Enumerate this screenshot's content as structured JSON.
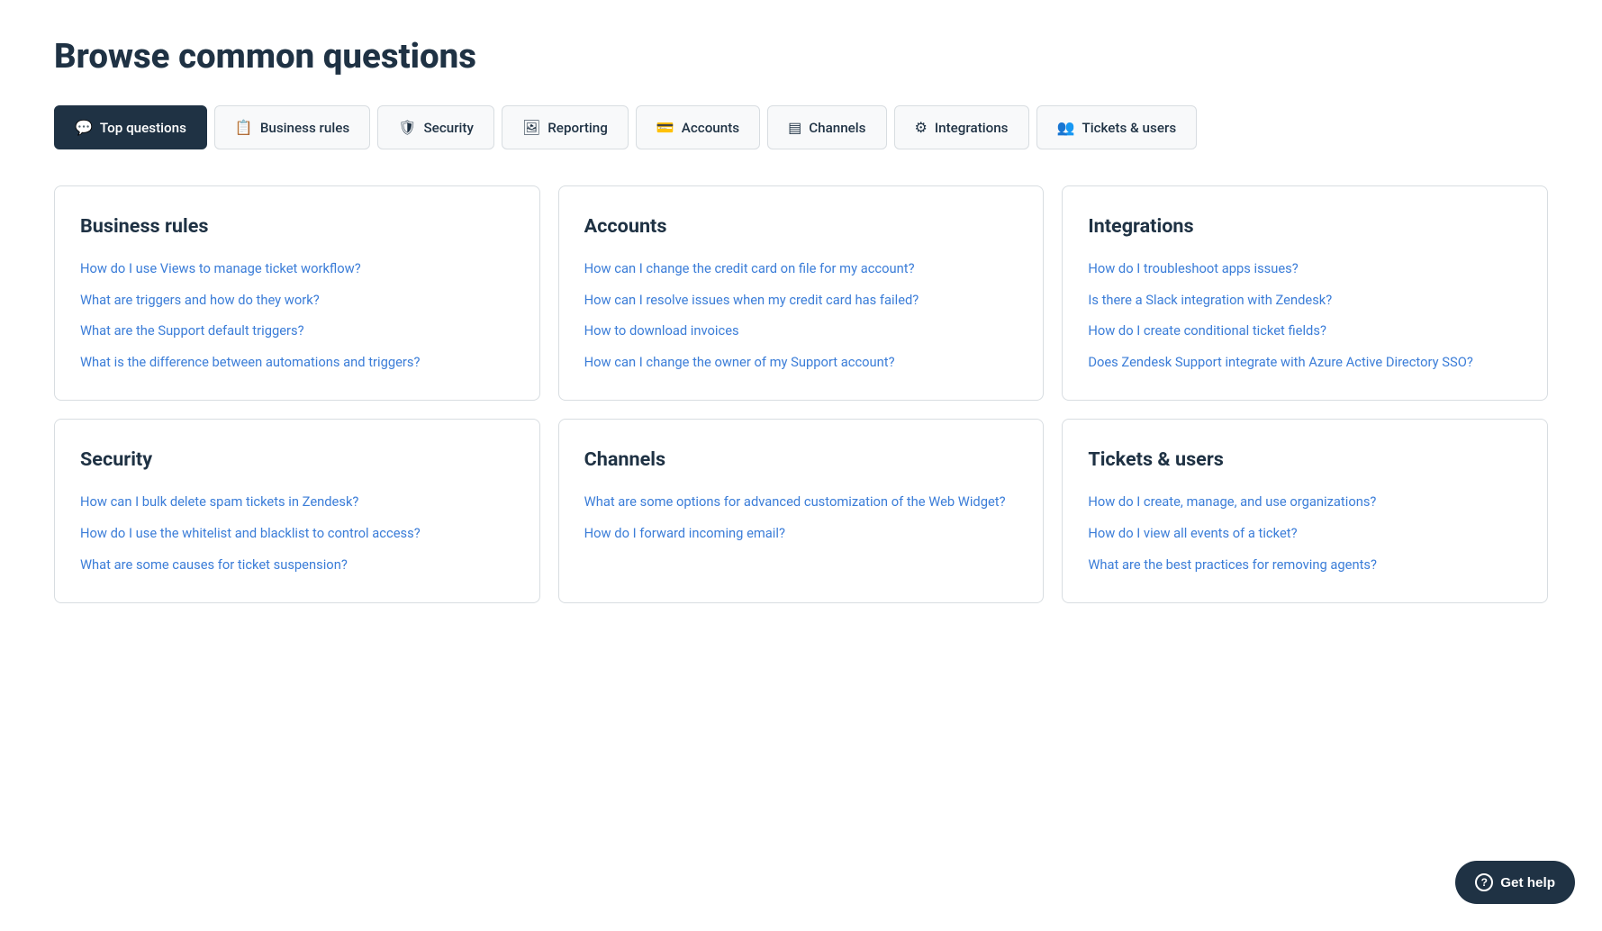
{
  "page": {
    "title": "Browse common questions"
  },
  "tabs": [
    {
      "id": "top-questions",
      "label": "Top questions",
      "icon": "💬",
      "active": true
    },
    {
      "id": "business-rules",
      "label": "Business rules",
      "icon": "📋",
      "active": false
    },
    {
      "id": "security",
      "label": "Security",
      "icon": "🛡",
      "active": false
    },
    {
      "id": "reporting",
      "label": "Reporting",
      "icon": "🖼",
      "active": false
    },
    {
      "id": "accounts",
      "label": "Accounts",
      "icon": "💳",
      "active": false
    },
    {
      "id": "channels",
      "label": "Channels",
      "icon": "📊",
      "active": false
    },
    {
      "id": "integrations",
      "label": "Integrations",
      "icon": "⚙",
      "active": false
    },
    {
      "id": "tickets-users",
      "label": "Tickets & users",
      "icon": "👥",
      "active": false
    }
  ],
  "cards": [
    {
      "id": "business-rules",
      "title": "Business rules",
      "links": [
        "How do I use Views to manage ticket workflow?",
        "What are triggers and how do they work?",
        "What are the Support default triggers?",
        "What is the difference between automations and triggers?"
      ]
    },
    {
      "id": "accounts",
      "title": "Accounts",
      "links": [
        "How can I change the credit card on file for my account?",
        "How can I resolve issues when my credit card has failed?",
        "How to download invoices",
        "How can I change the owner of my Support account?"
      ]
    },
    {
      "id": "integrations",
      "title": "Integrations",
      "links": [
        "How do I troubleshoot apps issues?",
        "Is there a Slack integration with Zendesk?",
        "How do I create conditional ticket fields?",
        "Does Zendesk Support integrate with Azure Active Directory SSO?"
      ]
    },
    {
      "id": "security",
      "title": "Security",
      "links": [
        "How can I bulk delete spam tickets in Zendesk?",
        "How do I use the whitelist and blacklist to control access?",
        "What are some causes for ticket suspension?"
      ]
    },
    {
      "id": "channels",
      "title": "Channels",
      "links": [
        "What are some options for advanced customization of the Web Widget?",
        "How do I forward incoming email?"
      ]
    },
    {
      "id": "tickets-users",
      "title": "Tickets & users",
      "links": [
        "How do I create, manage, and use organizations?",
        "How do I view all events of a ticket?",
        "What are the best practices for removing agents?"
      ]
    }
  ],
  "get_help_button": {
    "label": "Get help",
    "icon_label": "?"
  }
}
